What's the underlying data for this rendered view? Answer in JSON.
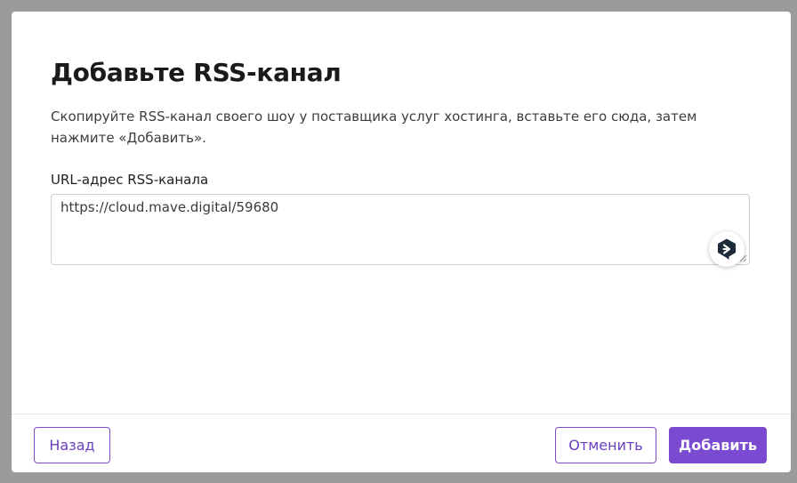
{
  "dialog": {
    "title": "Добавьте RSS-канал",
    "description": "Скопируйте RSS-канал своего шоу у поставщика услуг хостинга, вставьте его сюда, затем нажмите «Добавить».",
    "field": {
      "label": "URL-адрес RSS-канала",
      "value": "https://cloud.mave.digital/59680"
    },
    "extension_icon": "chat-translate-extension-icon",
    "buttons": {
      "back": "Назад",
      "cancel": "Отменить",
      "add": "Добавить"
    }
  },
  "colors": {
    "backdrop": "#9b9b9b",
    "accent": "#7a4ad0",
    "extension_badge": "#1c2a3a"
  }
}
